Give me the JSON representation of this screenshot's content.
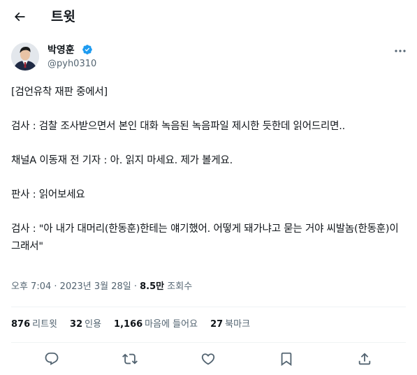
{
  "header": {
    "title": "트윗",
    "back_icon": "arrow-left-icon"
  },
  "tweet": {
    "author": {
      "name": "박영훈",
      "handle": "@pyh0310",
      "verified": true,
      "verified_color": "#1d9bf0"
    },
    "text": "[검언유착 재판 중에서]\n\n검사 : 검찰 조사받으면서 본인 대화 녹음된 녹음파일 제시한 듯한데 읽어드리면..\n\n채널A 이동재 전 기자 : 아. 읽지 마세요. 제가 볼게요.\n\n판사 : 읽어보세요\n\n검사 : \"아 내가 대머리(한동훈)한테는 얘기했어. 어떻게 돼가냐고 묻는 거야 씨발놈(한동훈)이 그래서\"",
    "time": "오후 7:04",
    "separator": "·",
    "date": "2023년 3월 28일",
    "views_count": "8.5만",
    "views_label": "조회수"
  },
  "stats": {
    "retweets": {
      "count": "876",
      "label": "리트윗"
    },
    "quotes": {
      "count": "32",
      "label": "인용"
    },
    "likes": {
      "count": "1,166",
      "label": "마음에 들어요"
    },
    "bookmarks": {
      "count": "27",
      "label": "북마크"
    }
  },
  "actions": [
    "reply-icon",
    "retweet-icon",
    "like-icon",
    "bookmark-icon",
    "share-icon"
  ],
  "colors": {
    "text": "#0f1419",
    "secondary": "#536471",
    "divider": "#eff3f4",
    "accent": "#1d9bf0"
  }
}
